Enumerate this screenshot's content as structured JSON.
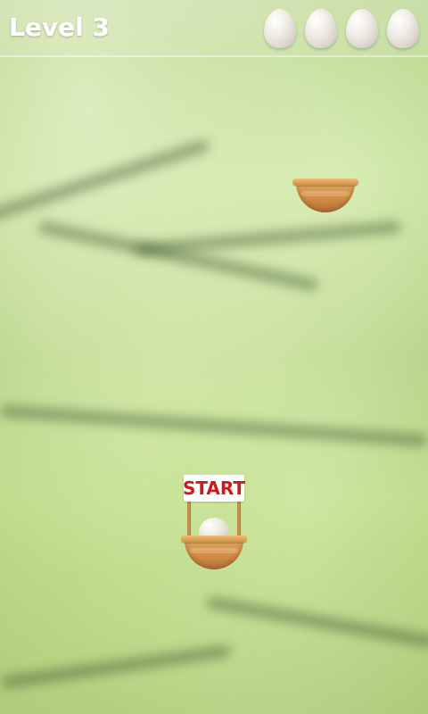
{
  "hud": {
    "level_label": "Level 3",
    "lives_remaining": 4,
    "life_icon": "egg-icon"
  },
  "game": {
    "start_sign_text": "START",
    "baskets": [
      {
        "name": "top-basket",
        "has_egg": false
      },
      {
        "name": "start-basket",
        "has_egg": true
      }
    ]
  }
}
